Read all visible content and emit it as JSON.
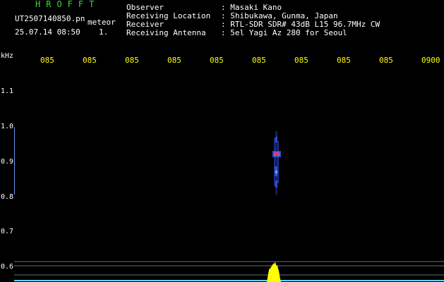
{
  "header": {
    "app_title": "HROFFT",
    "filename": "UT2507140850.pn",
    "mode": "meteor",
    "datetime": "25.07.14 08:50",
    "count": "1."
  },
  "info": {
    "labels": [
      "Observer",
      "Receiving Location",
      "Receiver",
      "Receiving Antenna"
    ],
    "values": [
      ": Masaki Kano",
      ": Shibukawa, Gunma, Japan",
      ": RTL-SDR SDR# 43dB L15 96.7MHz CW",
      ": 5el Yagi Az 280 for Seoul"
    ]
  },
  "time_axis": {
    "ticks": [
      "085",
      "085",
      "085",
      "085",
      "085",
      "085",
      "085",
      "085",
      "085",
      "0900"
    ]
  },
  "freq_axis": {
    "unit": "kHz",
    "ticks": [
      "1.1",
      "1.0",
      "0.9",
      "0.8",
      "0.7",
      "0.6"
    ]
  },
  "colors": {
    "background": "#000000",
    "title": "#3dd63d",
    "time_ticks": "#ffff00",
    "text": "#ffffff",
    "gridline": "#6e6e6e",
    "echo_core": "#ff2a2a",
    "echo_halo": "#2b4fd6",
    "spectrum_peak": "#ffff00",
    "spectrum_base": "#5fd3ff"
  }
}
